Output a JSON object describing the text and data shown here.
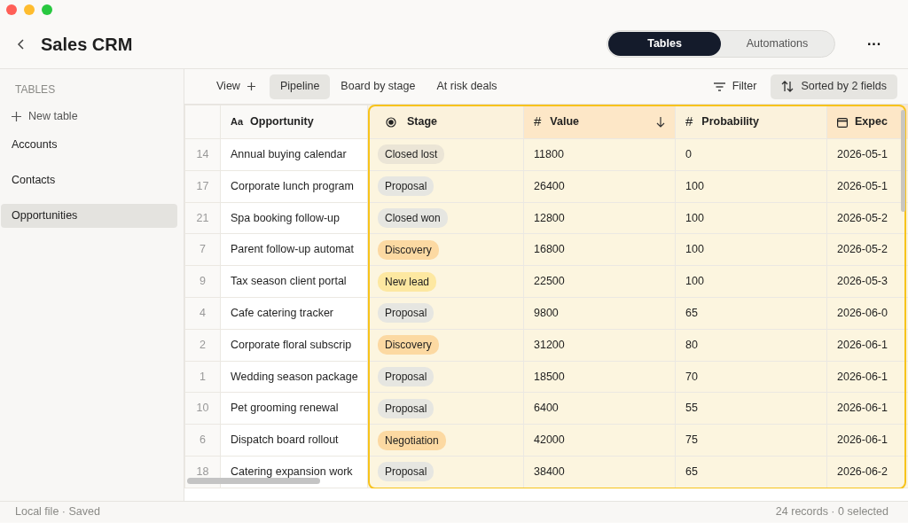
{
  "app": {
    "title": "Sales CRM"
  },
  "mode_tabs": [
    {
      "label": "Tables",
      "selected": true
    },
    {
      "label": "Automations",
      "selected": false
    }
  ],
  "more": "···",
  "sidebar": {
    "heading": "TABLES",
    "new_table": "New table",
    "items": [
      {
        "label": "Accounts",
        "selected": false
      },
      {
        "label": "Contacts",
        "selected": false
      },
      {
        "label": "Opportunities",
        "selected": true
      }
    ]
  },
  "views": {
    "add": "View",
    "tabs": [
      {
        "label": "Pipeline",
        "selected": true
      },
      {
        "label": "Board by stage",
        "selected": false
      },
      {
        "label": "At risk deals",
        "selected": false
      }
    ],
    "filter": "Filter",
    "sort": "Sorted by 2 fields"
  },
  "table": {
    "columns": [
      {
        "label": "Opportunity",
        "kind": "text",
        "glyph": "Aa",
        "highlighted": false,
        "sorted": false,
        "sort_arrow": false
      },
      {
        "label": "Stage",
        "kind": "select",
        "highlighted": true,
        "sorted": false,
        "sort_arrow": false
      },
      {
        "label": "Value",
        "kind": "number",
        "glyph": "#",
        "highlighted": true,
        "sorted": true,
        "sort_arrow": true
      },
      {
        "label": "Probability",
        "kind": "number",
        "glyph": "#",
        "highlighted": true,
        "sorted": false,
        "sort_arrow": false
      },
      {
        "label": "Expec",
        "kind": "date",
        "highlighted": true,
        "sorted": true,
        "sort_arrow": false
      }
    ],
    "rows": [
      {
        "number": "14",
        "cells": [
          "Annual buying calendar",
          {
            "label": "Closed lost",
            "color": "#ebe5d6"
          },
          "11800",
          "0",
          "2026-05-1"
        ]
      },
      {
        "number": "17",
        "cells": [
          "Corporate lunch program",
          {
            "label": "Proposal",
            "color": "#e6e6e1"
          },
          "26400",
          "100",
          "2026-05-1"
        ]
      },
      {
        "number": "21",
        "cells": [
          "Spa booking follow-up",
          {
            "label": "Closed won",
            "color": "#e6e6e1"
          },
          "12800",
          "100",
          "2026-05-2"
        ]
      },
      {
        "number": "7",
        "cells": [
          "Parent follow-up automat",
          {
            "label": "Discovery",
            "color": "#fcd9a2"
          },
          "16800",
          "100",
          "2026-05-2"
        ]
      },
      {
        "number": "9",
        "cells": [
          "Tax season client portal",
          {
            "label": "New lead",
            "color": "#fde8a1"
          },
          "22500",
          "100",
          "2026-05-3"
        ]
      },
      {
        "number": "4",
        "cells": [
          "Cafe catering tracker",
          {
            "label": "Proposal",
            "color": "#e6e6e1"
          },
          "9800",
          "65",
          "2026-06-0"
        ]
      },
      {
        "number": "2",
        "cells": [
          "Corporate floral subscrip",
          {
            "label": "Discovery",
            "color": "#fcd9a2"
          },
          "31200",
          "80",
          "2026-06-1"
        ]
      },
      {
        "number": "1",
        "cells": [
          "Wedding season package",
          {
            "label": "Proposal",
            "color": "#e6e6e1"
          },
          "18500",
          "70",
          "2026-06-1"
        ]
      },
      {
        "number": "10",
        "cells": [
          "Pet grooming renewal",
          {
            "label": "Proposal",
            "color": "#e6e6e1"
          },
          "6400",
          "55",
          "2026-06-1"
        ]
      },
      {
        "number": "6",
        "cells": [
          "Dispatch board rollout",
          {
            "label": "Negotiation",
            "color": "#fcd9a2"
          },
          "42000",
          "75",
          "2026-06-1"
        ]
      },
      {
        "number": "18",
        "cells": [
          "Catering expansion work",
          {
            "label": "Proposal",
            "color": "#e6e6e1"
          },
          "38400",
          "65",
          "2026-06-2"
        ]
      }
    ]
  },
  "status_bar": {
    "left": "Local file · Saved",
    "right": "24 records · 0 selected"
  }
}
